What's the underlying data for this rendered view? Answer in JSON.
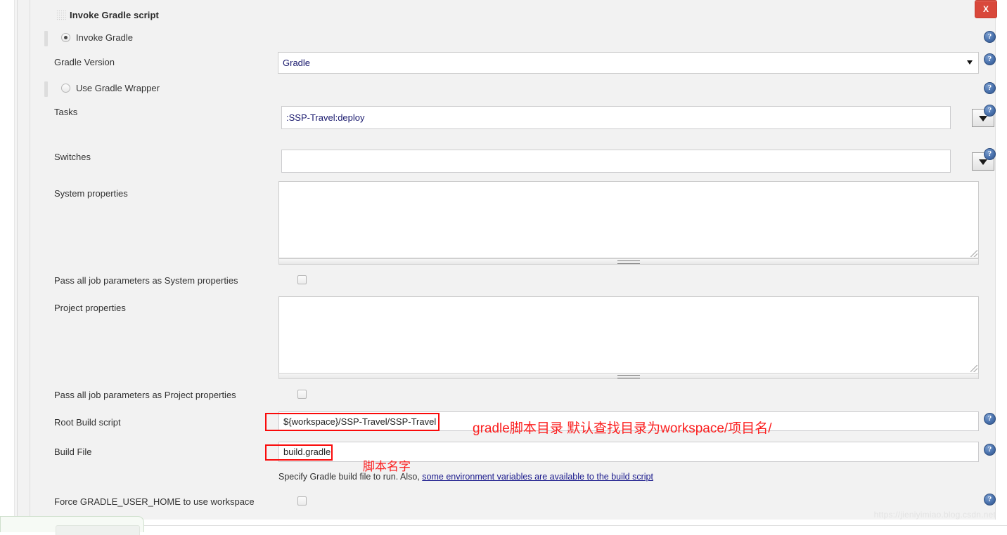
{
  "panel": {
    "title": "Invoke Gradle script",
    "close_label": "X",
    "drag_handle": "drag-handle"
  },
  "options": {
    "invoke_gradle": "Invoke Gradle",
    "use_gradle_wrapper": "Use Gradle Wrapper",
    "selected": "invoke_gradle"
  },
  "fields": {
    "gradle_version": {
      "label": "Gradle Version",
      "value": "Gradle",
      "options": [
        "Gradle"
      ]
    },
    "tasks": {
      "label": "Tasks",
      "value": ":SSP-Travel:deploy",
      "placeholder": ""
    },
    "switches": {
      "label": "Switches",
      "value": "",
      "placeholder": ""
    },
    "system_properties": {
      "label": "System properties",
      "value": "",
      "placeholder": ""
    },
    "pass_system": {
      "label": "Pass all job parameters as System properties",
      "checked": false
    },
    "project_properties": {
      "label": "Project properties",
      "value": "",
      "placeholder": ""
    },
    "pass_project": {
      "label": "Pass all job parameters as Project properties",
      "checked": false
    },
    "root_build_script": {
      "label": "Root Build script",
      "value": "${workspace}/SSP-Travel/SSP-Travel",
      "placeholder": ""
    },
    "build_file": {
      "label": "Build File",
      "value": "build.gradle",
      "placeholder": "",
      "help_prefix": "Specify Gradle build file to run. Also,",
      "help_link": "some environment variables are available to the build script"
    },
    "force_gradle_user_home": {
      "label": "Force GRADLE_USER_HOME to use workspace",
      "checked": false
    }
  },
  "annotations": {
    "root_build_script_note": "gradle脚本目录  默认查找目录为workspace/项目名/",
    "build_file_note": "脚本名字"
  },
  "watermark": "https://jieniyimiao.blog.csdn.net",
  "icons": {
    "help": "help-icon",
    "dropdown": "chevron-down-icon"
  },
  "colors": {
    "close_red": "#d9483b",
    "annotation_red": "#fa0a0a",
    "help_blue": "#4a72ad",
    "panel_bg": "#f2f2f2"
  }
}
